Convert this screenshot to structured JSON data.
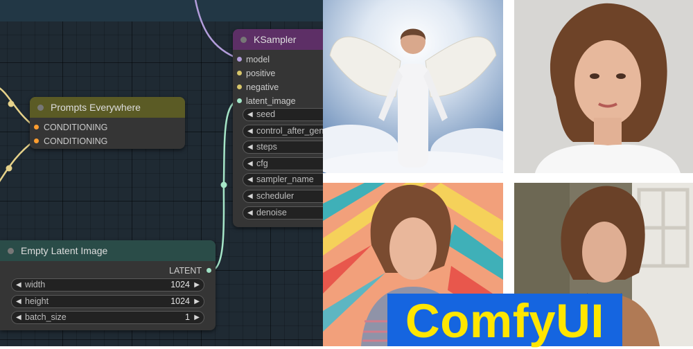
{
  "app": {
    "name": "ComfyUI"
  },
  "nodes": {
    "ksampler": {
      "title": "KSampler",
      "title_color": "#5d2f66",
      "inputs": [
        "model",
        "positive",
        "negative",
        "latent_image"
      ],
      "input_colors": [
        "#b39ddb",
        "#ffb74d",
        "#ffb74d",
        "#a5d6c2"
      ],
      "widgets": [
        "seed",
        "control_after_generate",
        "steps",
        "cfg",
        "sampler_name",
        "scheduler",
        "denoise"
      ]
    },
    "prompts_everywhere": {
      "title": "Prompts Everywhere",
      "title_color": "#5b5b25",
      "inputs": [
        "CONDITIONING",
        "CONDITIONING"
      ],
      "input_color": "#ff9d2f"
    },
    "empty_latent": {
      "title": "Empty Latent Image",
      "title_color": "#2a4c48",
      "output": "LATENT",
      "output_color": "#9fe0c4",
      "widgets": [
        {
          "label": "width",
          "value": "1024"
        },
        {
          "label": "height",
          "value": "1024"
        },
        {
          "label": "batch_size",
          "value": "1"
        }
      ]
    }
  },
  "wire_colors": {
    "model": "#b39ddb",
    "conditioning": "#e6d28a",
    "latent": "#a5e6c8"
  },
  "gallery": {
    "images": [
      {
        "subject": "angel-woman-with-white-wings-in-clouds"
      },
      {
        "subject": "portrait-woman-brown-bob-hair-white-shirt"
      },
      {
        "subject": "woman-colorful-chevron-wall-knit-sweater"
      },
      {
        "subject": "woman-brown-tee-window-background"
      }
    ]
  },
  "banner": {
    "text": "ComfyUI",
    "bg": "#1565e0",
    "fg": "#ffe600"
  }
}
